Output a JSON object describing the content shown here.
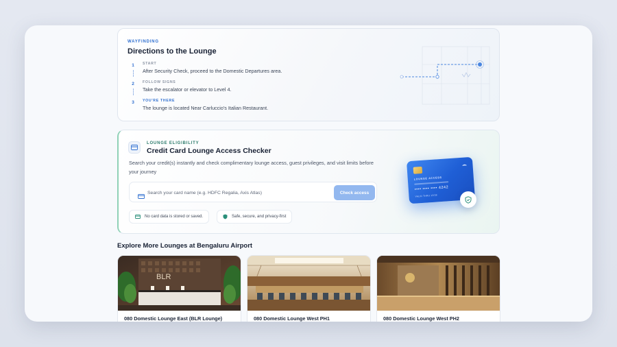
{
  "directions": {
    "eyebrow": "WAYFINDING",
    "title": "Directions to the Lounge",
    "steps": [
      {
        "num": "1",
        "label": "START",
        "text": "After Security Check, proceed to the Domestic Departures area."
      },
      {
        "num": "2",
        "label": "FOLLOW SIGNS",
        "text": "Take the escalator or elevator to Level 4."
      },
      {
        "num": "3",
        "label": "YOU'RE THERE",
        "text": "The lounge is located Near Carluccio's Italian Restaurant."
      }
    ]
  },
  "checker": {
    "eyebrow": "LOUNGE ELIGIBILITY",
    "title": "Credit Card Lounge Access Checker",
    "description": "Search your credit(s) instantly and check complimentary lounge access, guest privileges, and visit limits before your journey",
    "search_placeholder": "Search your card name (e.g. HDFC Regalia, Axis Atlas)",
    "search_value": "",
    "button_label": "Check access",
    "chips": [
      "No card data is stored or saved.",
      "Safe, secure, and privacy-first"
    ],
    "card": {
      "brand": "LOUNGE ACCESS",
      "number": "•••• •••• •••• 4242",
      "valid": "VALID THRU  12/28"
    }
  },
  "explore": {
    "title": "Explore More Lounges at Bengaluru Airport",
    "lounges": [
      {
        "name": "080 Domestic Lounge East (BLR Lounge)",
        "sign": "BLR"
      },
      {
        "name": "080 Domestic Lounge West PH1"
      },
      {
        "name": "080 Domestic Lounge West PH2"
      }
    ]
  },
  "colors": {
    "accent": "#2f6fd0",
    "button": "#93b8ef",
    "card_blue": "#1f5fd6",
    "teal": "#2a7a6a"
  }
}
